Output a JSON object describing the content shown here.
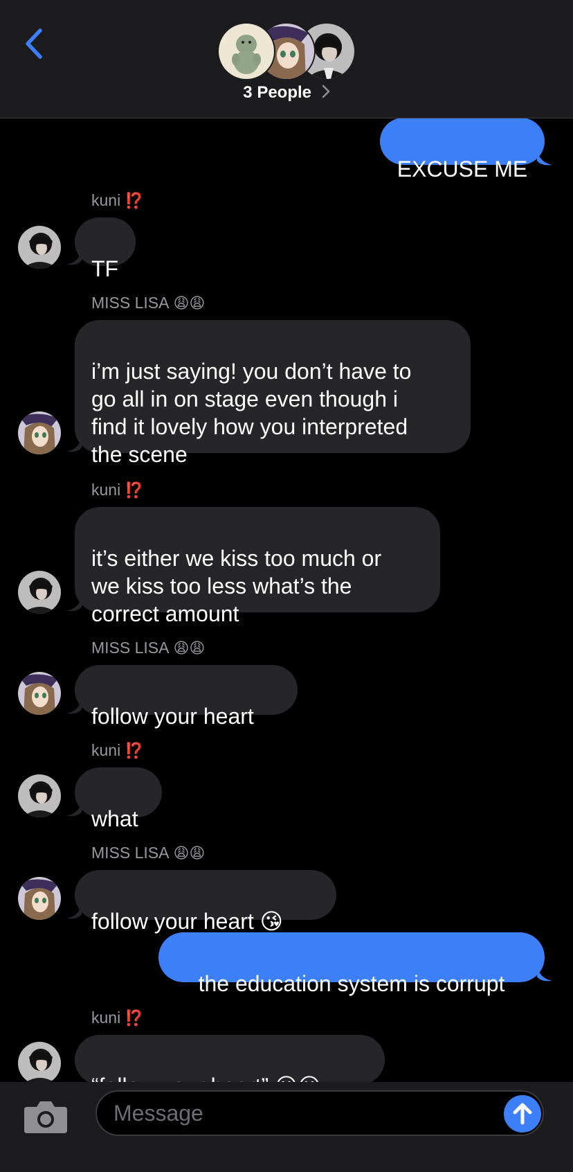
{
  "header": {
    "title": "3 People",
    "back_icon": "chevron-left-icon",
    "accent": "#3d7ff6"
  },
  "messages": [
    {
      "kind": "outgoing",
      "text": "EXCUSE ME"
    },
    {
      "kind": "incoming",
      "sender": "kuni",
      "sender_emoji": "⁉️",
      "text": "TF"
    },
    {
      "kind": "incoming",
      "sender": "MISS LISA",
      "sender_emoji": "😩😩",
      "text": "i’m just saying! you don’t have to\ngo all in on stage even though i\nfind it lovely how you interpreted\nthe scene"
    },
    {
      "kind": "incoming",
      "sender": "kuni",
      "sender_emoji": "⁉️",
      "text": "it’s either we kiss too much or\nwe kiss too less what’s the\ncorrect amount"
    },
    {
      "kind": "incoming",
      "sender": "MISS LISA",
      "sender_emoji": "😩😩",
      "text": "follow your heart"
    },
    {
      "kind": "incoming",
      "sender": "kuni",
      "sender_emoji": "⁉️",
      "text": "what"
    },
    {
      "kind": "incoming",
      "sender": "MISS LISA",
      "sender_emoji": "😩😩",
      "text": "follow your heart 😘"
    },
    {
      "kind": "outgoing",
      "text": "the education system is corrupt"
    },
    {
      "kind": "incoming",
      "sender": "kuni",
      "sender_emoji": "⁉️",
      "text": "“follow your heart” 😐😐"
    }
  ],
  "input": {
    "placeholder": "Message",
    "camera_icon": "camera-icon",
    "send_icon": "arrow-up-icon"
  }
}
